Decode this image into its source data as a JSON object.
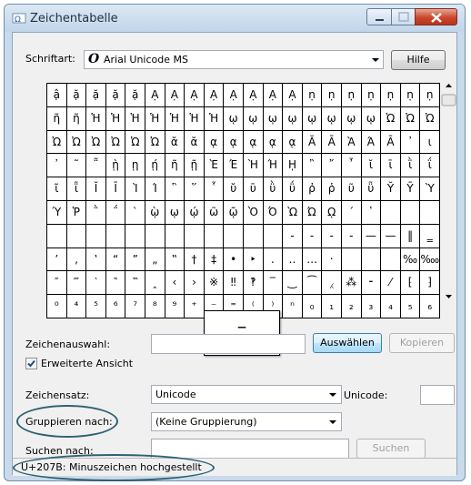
{
  "window": {
    "title": "Zeichentabelle"
  },
  "font": {
    "label": "Schriftart:",
    "icon_glyph": "O",
    "value": "Arial Unicode MS",
    "help_button": "Hilfe"
  },
  "grid": {
    "rows": [
      [
        "ậ",
        "ặ",
        "ặ",
        "ặ",
        "ặ",
        "Ạ",
        "Ạ",
        "Ạ",
        "Ạ",
        "Ạ",
        "Ạ",
        "Ạ",
        "Ạ",
        "ṇ",
        "ṇ",
        "ṇ",
        "ṇ",
        "ṇ",
        "ṇ",
        "ṇ"
      ],
      [
        "ῆ",
        "ῆ",
        "Ἡ",
        "Ἡ",
        "Ἡ",
        "Ἡ",
        "Ἡ",
        "Ἡ",
        "Ἡ",
        "ῳ",
        "ῳ",
        "ῳ",
        "ῳ",
        "ῳ",
        "ῳ",
        "ῳ",
        "ῳ",
        "Ὠ",
        "Ὠ",
        "Ὠ"
      ],
      [
        "Ὠ",
        "Ὠ",
        "Ὠ",
        "Ὠ",
        "Ὠ",
        "Ὠ",
        "ᾰ",
        "ᾰ",
        "ᾳ",
        "ᾳ",
        "ᾳ",
        "ᾳ",
        "ᾳ",
        "Ᾰ",
        "Ᾱ",
        "Ὰ",
        "Ά",
        "Ᾱ",
        "᾽",
        "ι"
      ],
      [
        "᾿",
        "῀",
        "῁",
        "ῂ",
        "ῃ",
        "ῄ",
        "ῆ",
        "ῇ",
        "Ὲ",
        "Έ",
        "Ὴ",
        "Ή",
        "ῌ",
        "῍",
        "῎",
        "῏",
        "ῐ",
        "ῑ",
        "ῒ",
        "ΐ"
      ],
      [
        "ῖ",
        "ῗ",
        "Ῐ",
        "Ῑ",
        "Ὶ",
        "Ί",
        "῝",
        "῞",
        "῟",
        "ῠ",
        "ῡ",
        "ῢ",
        "ΰ",
        "ῤ",
        "ῥ",
        "ῦ",
        "ῧ",
        "Ῠ",
        "Ῡ",
        "Ὺ"
      ],
      [
        "Ύ",
        "Ῥ",
        "῭",
        "΅",
        "`",
        "ῲ",
        "ῳ",
        "ῴ",
        "ῶ",
        "ῷ",
        "Ὸ",
        "Ό",
        "Ὼ",
        "Ώ",
        "ῼ",
        "´",
        "῾",
        "",
        "",
        ""
      ],
      [
        "",
        "",
        "",
        "",
        "",
        "",
        "",
        "",
        "",
        "",
        "",
        "",
        "-",
        "-",
        "-",
        "-",
        "—",
        "—",
        "‖",
        "‗",
        "‘"
      ],
      [
        "’",
        "‚",
        "‛",
        "“",
        "”",
        "„",
        "‟",
        "†",
        "‡",
        "•",
        "‣",
        "․",
        "‥",
        "…",
        "‧",
        "",
        "",
        "",
        "‰",
        "‱",
        "′"
      ],
      [
        "″",
        "‴",
        "‵",
        "‶",
        "‷",
        "‸",
        "‹",
        "›",
        "※",
        "‼",
        "‽",
        "‾",
        "‿",
        "⁀",
        "⁁",
        "⁂",
        "⁃",
        "⁄",
        "⁅",
        "⁆"
      ],
      [
        "⁰",
        "⁴",
        "⁵",
        "⁶",
        "⁷",
        "⁸",
        "⁹",
        "⁺",
        "⁻",
        "⁼",
        "⁽",
        "⁾",
        "ⁿ",
        "₀",
        "₁",
        "₂",
        "₃",
        "₄",
        "₅",
        "₆"
      ]
    ],
    "zoom_glyph": "⁻"
  },
  "selection": {
    "label": "Zeichenauswahl:",
    "value": "",
    "select_button": "Auswählen",
    "copy_button": "Kopieren"
  },
  "advanced": {
    "label": "Erweiterte Ansicht",
    "checked": true
  },
  "charset": {
    "label": "Zeichensatz:",
    "value": "Unicode",
    "unicode_label": "Unicode:",
    "unicode_value": ""
  },
  "group": {
    "label": "Gruppieren nach:",
    "value": "(Keine Gruppierung)"
  },
  "search": {
    "label": "Suchen nach:",
    "value": "",
    "button": "Suchen"
  },
  "status": {
    "text": "U+207B: Minuszeichen hochgestellt"
  },
  "colors": {
    "highlight_ellipse": "#2f6272",
    "window_frame": "#c9daeb"
  }
}
